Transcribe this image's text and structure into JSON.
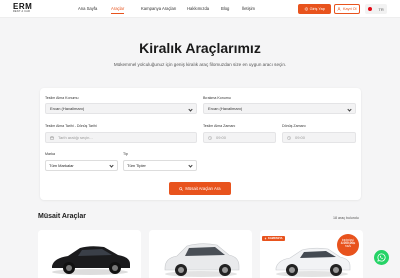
{
  "header": {
    "logo_text": "ERM",
    "logo_sub": "RENT A CAR",
    "nav": [
      {
        "label": "Ana Sayfa",
        "active": false
      },
      {
        "label": "Araçlar",
        "active": true
      },
      {
        "label": "Kampanya Araçları",
        "active": false
      },
      {
        "label": "Hakkımızda",
        "active": false
      },
      {
        "label": "Blog",
        "active": false
      },
      {
        "label": "İletişim",
        "active": false
      }
    ],
    "login_label": "Giriş Yap",
    "register_label": "Kayıt Ol",
    "lang": "TR"
  },
  "hero": {
    "title": "Kiralık Araçlarımız",
    "subtitle": "Mükemmel yolculuğunuz için geniş kiralık araç filomuzdan size en uygun aracı seçin."
  },
  "search_form": {
    "pickup_label": "Teslim Alma Konumu",
    "pickup_value": "Ercan (Havalimanı)",
    "dropoff_label": "Bırakma Konumu",
    "dropoff_value": "Ercan (Havalimanı)",
    "dates_label": "Teslim Alma Tarihi - Dönüş Tarihi",
    "dates_placeholder": "Tarih aralığı seçin...",
    "pickup_time_label": "Teslim Alma Zamanı",
    "pickup_time_value": "09:00",
    "return_time_label": "Dönüş Zamanı",
    "return_time_value": "09:00",
    "brand_label": "Marka",
    "brand_value": "Tüm Markalar",
    "type_label": "Tip",
    "type_value": "Tüm Tipler",
    "search_button": "Müsait Araçları Ara"
  },
  "results": {
    "title": "Müsait Araçlar",
    "count_text": "18 araç bulundu",
    "campaign_badge": "KAMPANYA",
    "discount_line1": "İNDİRİMLİ",
    "discount_line2": "4.000,00₺",
    "discount_line3": "'DEN"
  },
  "colors": {
    "accent": "#e8531d",
    "whatsapp": "#25d366",
    "background": "#f5f5f6"
  }
}
